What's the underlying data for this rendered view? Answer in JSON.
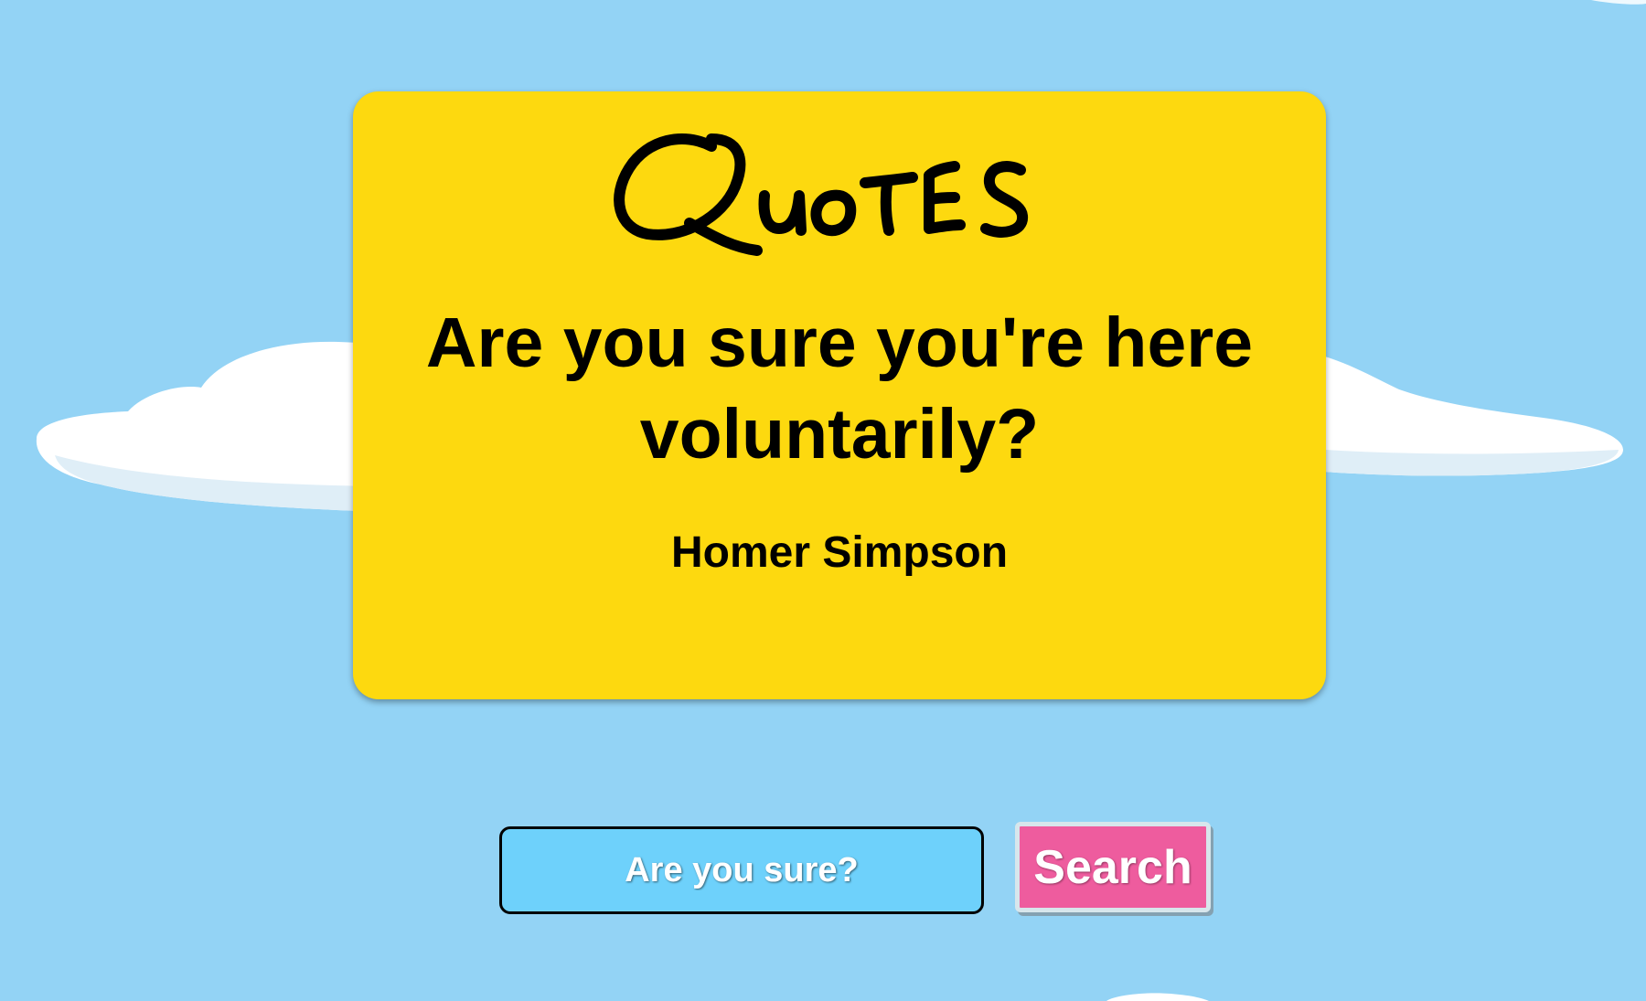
{
  "app": {
    "logo_text": "Quotes"
  },
  "quote": {
    "text": "Are you sure you're here voluntarily?",
    "author": "Homer Simpson"
  },
  "search": {
    "placeholder": "Are you sure?",
    "value": "",
    "button_label": "Search"
  },
  "colors": {
    "sky": "#93d3f5",
    "card": "#fdd90f",
    "input": "#6ed1fb",
    "button": "#ee5c9e",
    "text": "#000000"
  },
  "icons": {
    "clouds": "cloud-icon"
  }
}
